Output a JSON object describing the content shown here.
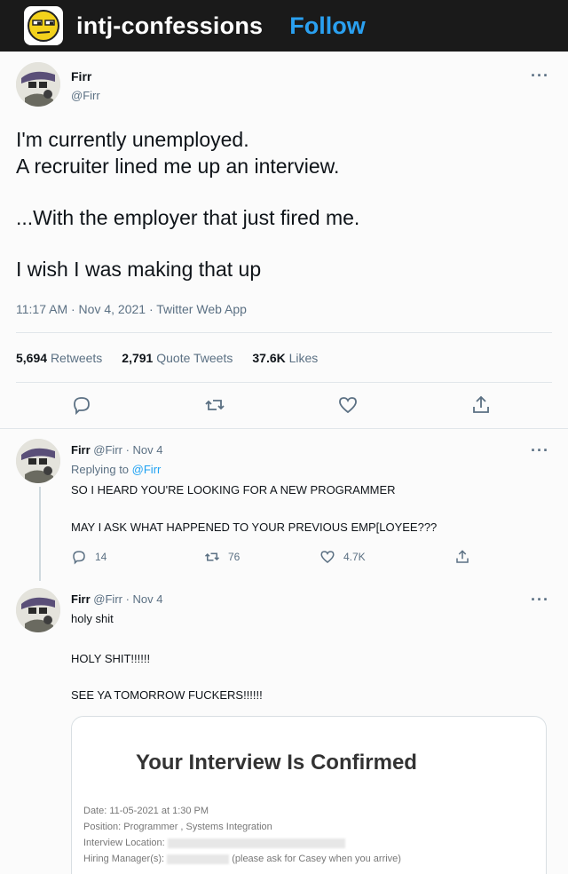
{
  "topbar": {
    "blog_name": "intj-confessions",
    "follow_label": "Follow"
  },
  "main_tweet": {
    "author_name": "Firr",
    "author_handle": "@Firr",
    "lines": [
      "I'm currently unemployed.",
      "A recruiter lined me up an interview.",
      "...With the employer that just fired me.",
      "I wish I was making that up"
    ],
    "meta": "11:17 AM · Nov 4, 2021 · Twitter Web App",
    "stats": [
      {
        "value": "5,694",
        "label": "Retweets"
      },
      {
        "value": "2,791",
        "label": "Quote Tweets"
      },
      {
        "value": "37.6K",
        "label": "Likes"
      }
    ]
  },
  "reply1": {
    "author_name": "Firr",
    "handle_date": "@Firr · Nov 4",
    "replying_prefix": "Replying to",
    "replying_handle": "@Firr",
    "line1": "SO I HEARD YOU'RE LOOKING FOR A NEW PROGRAMMER",
    "line2": "MAY I ASK WHAT HAPPENED TO YOUR PREVIOUS EMP[LOYEE???",
    "replies": "14",
    "retweets": "76",
    "likes": "4.7K"
  },
  "reply2": {
    "author_name": "Firr",
    "handle_date": "@Firr · Nov 4",
    "line1": "holy shit",
    "line2": "HOLY SHIT!!!!!!",
    "line3": "SEE YA TOMORROW FUCKERS!!!!!!"
  },
  "email_card": {
    "title": "Your Interview Is Confirmed",
    "date": "Date: 11-05-2021 at 1:30 PM",
    "position": "Position: Programmer , Systems Integration",
    "location_label": "Interview Location:",
    "manager_label": "Hiring Manager(s):",
    "manager_note": "(please ask for Casey when you arrive)"
  },
  "icons": {
    "more": "more-icon",
    "reply": "reply-icon",
    "retweet": "retweet-icon",
    "like": "heart-icon",
    "share": "share-icon"
  },
  "colors": {
    "follow": "#2aa0f0",
    "link": "#1da1f2",
    "topbar": "#1a1a1a"
  }
}
